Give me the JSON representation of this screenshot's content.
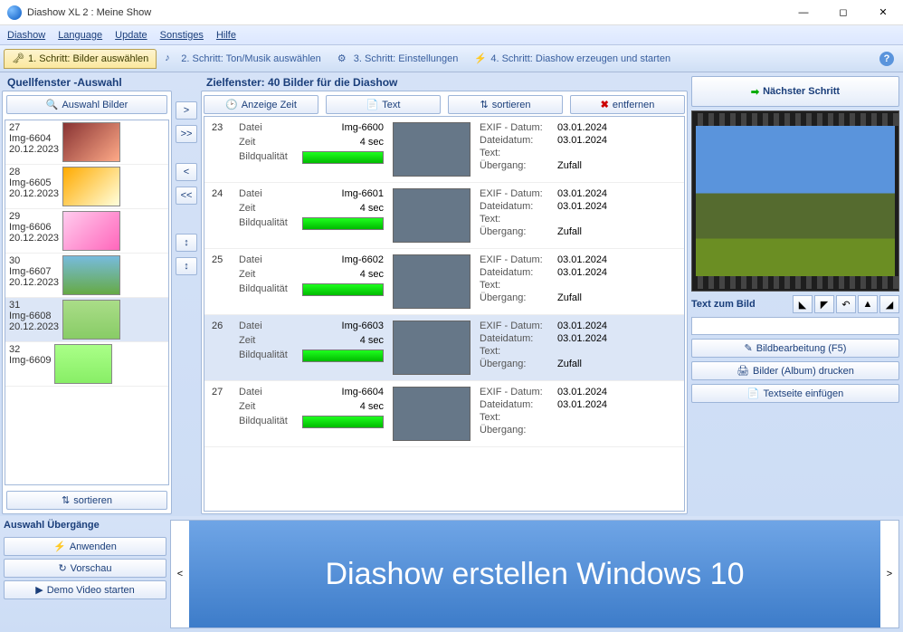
{
  "window": {
    "title": "Diashow XL 2 : Meine Show"
  },
  "menu": {
    "diashow": "Diashow",
    "language": "Language",
    "update": "Update",
    "sonstiges": "Sonstiges",
    "hilfe": "Hilfe"
  },
  "steps": {
    "s1": "1. Schritt: Bilder auswählen",
    "s2": "2. Schritt: Ton/Musik auswählen",
    "s3": "3. Schritt: Einstellungen",
    "s4": "4. Schritt: Diashow erzeugen und starten"
  },
  "source": {
    "heading": "Quellfenster -Auswahl",
    "select_btn": "Auswahl Bilder",
    "sort_btn": "sortieren",
    "items": [
      {
        "num": "27",
        "name": "Img-6604",
        "date": "20.12.2023"
      },
      {
        "num": "28",
        "name": "Img-6605",
        "date": "20.12.2023"
      },
      {
        "num": "29",
        "name": "Img-6606",
        "date": "20.12.2023"
      },
      {
        "num": "30",
        "name": "Img-6607",
        "date": "20.12.2023"
      },
      {
        "num": "31",
        "name": "Img-6608",
        "date": "20.12.2023"
      },
      {
        "num": "32",
        "name": "Img-6609",
        "date": ""
      }
    ]
  },
  "arrows": {
    "r": ">",
    "rr": ">>",
    "l": "<",
    "ll": "<<"
  },
  "target": {
    "heading": "Zielfenster: 40 Bilder für die Diashow",
    "bar": {
      "time": "Anzeige Zeit",
      "text": "Text",
      "sort": "sortieren",
      "remove": "entfernen"
    },
    "labels": {
      "datei": "Datei",
      "zeit": "Zeit",
      "qual": "Bildqualität",
      "exif": "EXIF - Datum:",
      "filedate": "Dateidatum:",
      "text": "Text:",
      "trans": "Übergang:"
    },
    "items": [
      {
        "num": "23",
        "file": "Img-6600",
        "time": "4 sec",
        "exif": "03.01.2024",
        "fdate": "03.01.2024",
        "trans": "Zufall"
      },
      {
        "num": "24",
        "file": "Img-6601",
        "time": "4 sec",
        "exif": "03.01.2024",
        "fdate": "03.01.2024",
        "trans": "Zufall"
      },
      {
        "num": "25",
        "file": "Img-6602",
        "time": "4 sec",
        "exif": "03.01.2024",
        "fdate": "03.01.2024",
        "trans": "Zufall"
      },
      {
        "num": "26",
        "file": "Img-6603",
        "time": "4 sec",
        "exif": "03.01.2024",
        "fdate": "03.01.2024",
        "trans": "Zufall"
      },
      {
        "num": "27",
        "file": "Img-6604",
        "time": "4 sec",
        "exif": "03.01.2024",
        "fdate": "03.01.2024",
        "trans": ""
      }
    ]
  },
  "right": {
    "next": "Nächster Schritt",
    "textlabel": "Text zum Bild",
    "edit": "Bildbearbeitung (F5)",
    "print": "Bilder (Album) drucken",
    "insert": "Textseite einfügen"
  },
  "bottom": {
    "heading": "Auswahl Übergänge",
    "apply": "Anwenden",
    "preview": "Vorschau",
    "demo": "Demo Video starten",
    "banner": "Diashow erstellen Windows 10",
    "prev": "<",
    "next": ">"
  }
}
